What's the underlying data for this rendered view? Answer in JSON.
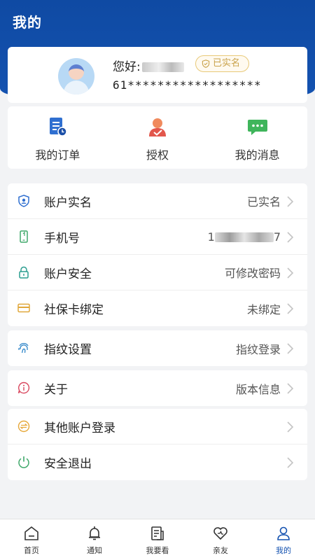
{
  "header": {
    "title": "我的"
  },
  "profile": {
    "greeting": "您好:",
    "verified_badge": "已实名",
    "id_number": "61******************"
  },
  "quick_actions": [
    {
      "label": "我的订单",
      "icon": "order-icon"
    },
    {
      "label": "授权",
      "icon": "authorize-icon"
    },
    {
      "label": "我的消息",
      "icon": "message-icon"
    }
  ],
  "account_menu": [
    {
      "label": "账户实名",
      "value": "已实名",
      "icon": "shield-id-icon"
    },
    {
      "label": "手机号",
      "value": "1",
      "value_tail": "7",
      "icon": "phone-icon"
    },
    {
      "label": "账户安全",
      "value": "可修改密码",
      "icon": "lock-icon"
    },
    {
      "label": "社保卡绑定",
      "value": "未绑定",
      "icon": "card-icon"
    }
  ],
  "fingerprint_menu": {
    "label": "指纹设置",
    "value": "指纹登录",
    "icon": "fingerprint-icon"
  },
  "about_menu": {
    "label": "关于",
    "value": "版本信息",
    "icon": "info-icon"
  },
  "other_menu": [
    {
      "label": "其他账户登录",
      "value": "",
      "icon": "switch-account-icon"
    },
    {
      "label": "安全退出",
      "value": "",
      "icon": "power-icon"
    }
  ],
  "bottom_nav": [
    {
      "label": "首页",
      "icon": "home-icon"
    },
    {
      "label": "通知",
      "icon": "bell-icon"
    },
    {
      "label": "我要看",
      "icon": "document-icon"
    },
    {
      "label": "亲友",
      "icon": "heart-icon"
    },
    {
      "label": "我的",
      "icon": "user-icon",
      "active": true
    }
  ],
  "colors": {
    "brand_blue": "#1452b0",
    "badge_gold": "#c9a24a",
    "page_bg": "#f2f3f5"
  }
}
